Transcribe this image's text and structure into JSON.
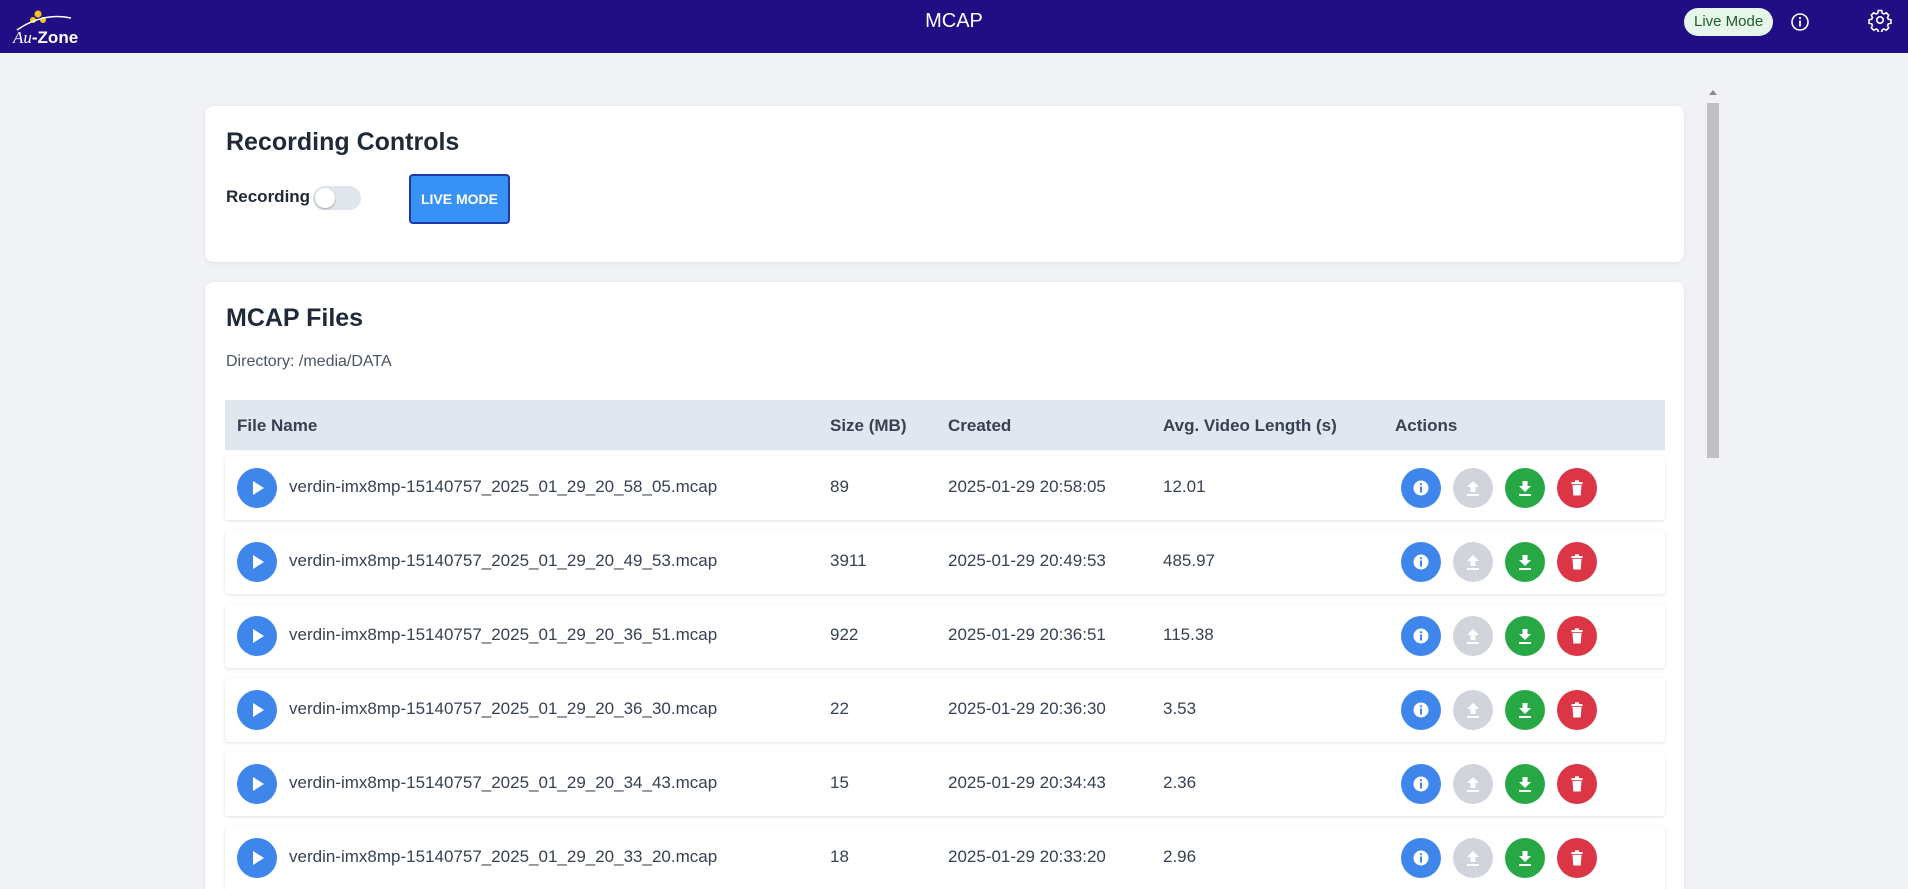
{
  "header": {
    "logo_prefix": "Au",
    "logo_suffix": "-Zone",
    "title": "MCAP",
    "live_badge": "Live Mode",
    "info_icon": "info-circle-icon",
    "settings_icon": "gear-icon"
  },
  "recording": {
    "title": "Recording Controls",
    "label": "Recording",
    "toggle_on": false,
    "live_button": "LIVE MODE"
  },
  "files": {
    "title": "MCAP Files",
    "directory": "Directory: /media/DATA",
    "columns": [
      "File Name",
      "Size (MB)",
      "Created",
      "Avg. Video Length (s)",
      "Actions"
    ],
    "rows": [
      {
        "name": "verdin-imx8mp-15140757_2025_01_29_20_58_05.mcap",
        "size": "89",
        "created": "2025-01-29 20:58:05",
        "avg": "12.01"
      },
      {
        "name": "verdin-imx8mp-15140757_2025_01_29_20_49_53.mcap",
        "size": "3911",
        "created": "2025-01-29 20:49:53",
        "avg": "485.97"
      },
      {
        "name": "verdin-imx8mp-15140757_2025_01_29_20_36_51.mcap",
        "size": "922",
        "created": "2025-01-29 20:36:51",
        "avg": "115.38"
      },
      {
        "name": "verdin-imx8mp-15140757_2025_01_29_20_36_30.mcap",
        "size": "22",
        "created": "2025-01-29 20:36:30",
        "avg": "3.53"
      },
      {
        "name": "verdin-imx8mp-15140757_2025_01_29_20_34_43.mcap",
        "size": "15",
        "created": "2025-01-29 20:34:43",
        "avg": "2.36"
      },
      {
        "name": "verdin-imx8mp-15140757_2025_01_29_20_33_20.mcap",
        "size": "18",
        "created": "2025-01-29 20:33:20",
        "avg": "2.96"
      }
    ],
    "action_icons": [
      "info-icon",
      "upload-icon",
      "download-icon",
      "trash-icon"
    ]
  },
  "colors": {
    "header_bg": "#210e85",
    "primary": "#3e86ec",
    "success": "#28a745",
    "danger": "#dc3545",
    "disabled": "#d1d5db"
  }
}
